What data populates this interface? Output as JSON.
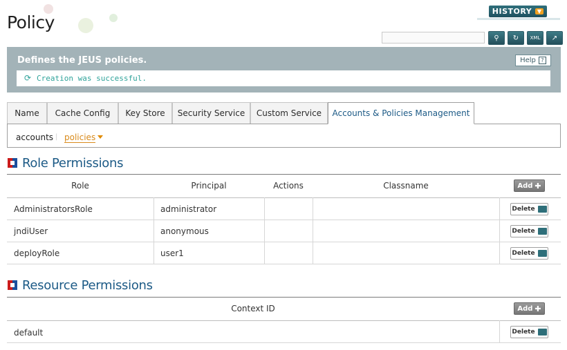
{
  "page": {
    "title": "Policy"
  },
  "header": {
    "history_label": "HISTORY",
    "search_placeholder": "",
    "tool_icons": [
      "search-icon",
      "refresh-icon",
      "xml-icon",
      "export-icon"
    ]
  },
  "info": {
    "description": "Defines the JEUS policies.",
    "help_label": "Help",
    "message": "Creation was successful."
  },
  "tabs": [
    {
      "label": "Name",
      "active": false
    },
    {
      "label": "Cache Config",
      "active": false
    },
    {
      "label": "Key Store",
      "active": false
    },
    {
      "label": "Security Service",
      "active": false
    },
    {
      "label": "Custom Service",
      "active": false
    },
    {
      "label": "Accounts & Policies Management",
      "active": true
    }
  ],
  "subtabs": {
    "accounts": "accounts",
    "policies": "policies",
    "separator": "|"
  },
  "role_permissions": {
    "title": "Role Permissions",
    "columns": [
      "Role",
      "Principal",
      "Actions",
      "Classname"
    ],
    "add_label": "Add",
    "delete_label": "Delete",
    "rows": [
      {
        "role": "AdministratorsRole",
        "principal": "administrator",
        "actions": "",
        "classname": ""
      },
      {
        "role": "jndiUser",
        "principal": "anonymous",
        "actions": "",
        "classname": ""
      },
      {
        "role": "deployRole",
        "principal": "user1",
        "actions": "",
        "classname": ""
      }
    ]
  },
  "resource_permissions": {
    "title": "Resource Permissions",
    "columns": [
      "Context ID"
    ],
    "add_label": "Add",
    "delete_label": "Delete",
    "rows": [
      {
        "context_id": "default"
      }
    ]
  },
  "colors": {
    "accent": "#1c5a86",
    "panel": "#a3b3b8",
    "success": "#2fa39a",
    "policies_active": "#d98a1a"
  }
}
